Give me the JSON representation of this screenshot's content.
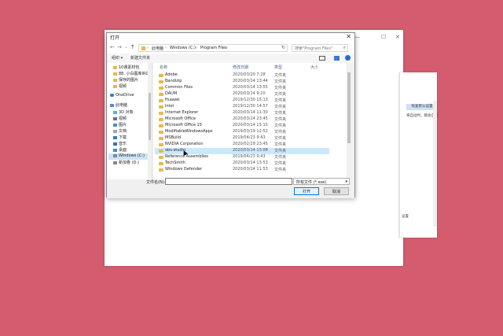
{
  "dialog": {
    "title": "打开",
    "close": "✕",
    "nav": {
      "back": "←",
      "forward": "→",
      "recent": "⌄",
      "up": "↑"
    },
    "breadcrumb": [
      "此电脑",
      "Windows (C:)",
      "Program Files"
    ],
    "sep": "›",
    "refresh": "↻",
    "search_placeholder": "搜索\"Program Files\"",
    "toolbar": {
      "organize": "组织 ▾",
      "new_folder": "新建文件夹"
    },
    "sidebar": [
      {
        "label": "10课素材包",
        "icon": "folder"
      },
      {
        "label": "88. 小白图库IRG",
        "icon": "folder"
      },
      {
        "label": "保存的图片",
        "icon": "folder"
      },
      {
        "label": "视频",
        "icon": "folder"
      },
      {
        "label": "OneDrive",
        "icon": "cloud"
      },
      {
        "label": "此电脑",
        "icon": "pc"
      },
      {
        "label": "3D 对象",
        "icon": "3d"
      },
      {
        "label": "视频",
        "icon": "video"
      },
      {
        "label": "图片",
        "icon": "picture"
      },
      {
        "label": "文档",
        "icon": "doc"
      },
      {
        "label": "下载",
        "icon": "download"
      },
      {
        "label": "音乐",
        "icon": "music"
      },
      {
        "label": "桌面",
        "icon": "desktop"
      },
      {
        "label": "Windows (C:)",
        "icon": "drive"
      },
      {
        "label": "新加卷 (D:)",
        "icon": "drive"
      }
    ],
    "columns": {
      "name": "名称",
      "date": "修改日期",
      "type": "类型",
      "size": "大小"
    },
    "files": [
      {
        "name": "Adobe",
        "date": "2020/03/20 7:28",
        "type": "文件夹"
      },
      {
        "name": "Bandizip",
        "date": "2020/03/14 13:44",
        "type": "文件夹"
      },
      {
        "name": "Common Files",
        "date": "2020/03/14 13:55",
        "type": "文件夹"
      },
      {
        "name": "DAUM",
        "date": "2020/03/14 9:20",
        "type": "文件夹"
      },
      {
        "name": "Huawei",
        "date": "2019/12/30 15:13",
        "type": "文件夹"
      },
      {
        "name": "Intel",
        "date": "2019/12/30 14:57",
        "type": "文件夹"
      },
      {
        "name": "Internet Explorer",
        "date": "2020/03/14 11:30",
        "type": "文件夹"
      },
      {
        "name": "Microsoft Office",
        "date": "2020/03/14 23:45",
        "type": "文件夹"
      },
      {
        "name": "Microsoft Office 15",
        "date": "2020/03/14 15:15",
        "type": "文件夹"
      },
      {
        "name": "ModifiableWindowsApps",
        "date": "2019/03/19 12:52",
        "type": "文件夹"
      },
      {
        "name": "MSBuild",
        "date": "2019/04/23 9:43",
        "type": "文件夹"
      },
      {
        "name": "NVIDIA Corporation",
        "date": "2020/02/29 23:45",
        "type": "文件夹"
      },
      {
        "name": "obs-studio",
        "date": "2020/03/14 13:08",
        "type": "文件夹"
      },
      {
        "name": "Reference Assemblies",
        "date": "2019/04/23 9:43",
        "type": "文件夹"
      },
      {
        "name": "TechSmith",
        "date": "2020/03/14 13:53",
        "type": "文件夹"
      },
      {
        "name": "Windows Defender",
        "date": "2020/03/14 11:53",
        "type": "文件夹"
      }
    ],
    "filename_label": "文件名(N):",
    "filename_value": "",
    "filetype": "所有文件 (*.exe)",
    "open_button": "打开",
    "cancel_button": "取消"
  },
  "background_window": {
    "min": "—",
    "max": "☐",
    "close": "✕"
  },
  "side_window": {
    "button_text": "恢复默认设置",
    "text1": "将自动时，都会自动",
    "text2": "设置"
  }
}
